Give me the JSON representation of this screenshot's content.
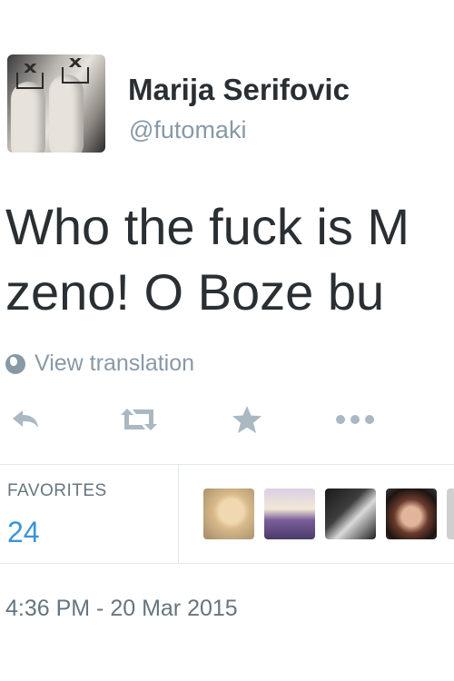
{
  "tweet": {
    "author": {
      "display_name": "Marija Serifovic",
      "screen_name": "@futomaki",
      "avatar_icon": "profile-photo"
    },
    "text_lines": [
      "Who the fuck is M",
      "zeno! O Boze bu"
    ],
    "translation_label": "View translation",
    "actions": [
      {
        "name": "reply",
        "icon": "reply-icon"
      },
      {
        "name": "retweet",
        "icon": "retweet-icon"
      },
      {
        "name": "favorite",
        "icon": "star-icon"
      },
      {
        "name": "more",
        "icon": "more-icon"
      }
    ],
    "stats": {
      "favorites_label": "FAVORITES",
      "favorites_count": "24"
    },
    "favoriters_count_visible": 5,
    "timestamp": "4:36 PM - 20 Mar 2015"
  },
  "colors": {
    "text": "#292f33",
    "secondary_text": "#8899a6",
    "accent": "#3b94d9",
    "icon": "#aab8c2",
    "divider": "#e1e8ed"
  }
}
